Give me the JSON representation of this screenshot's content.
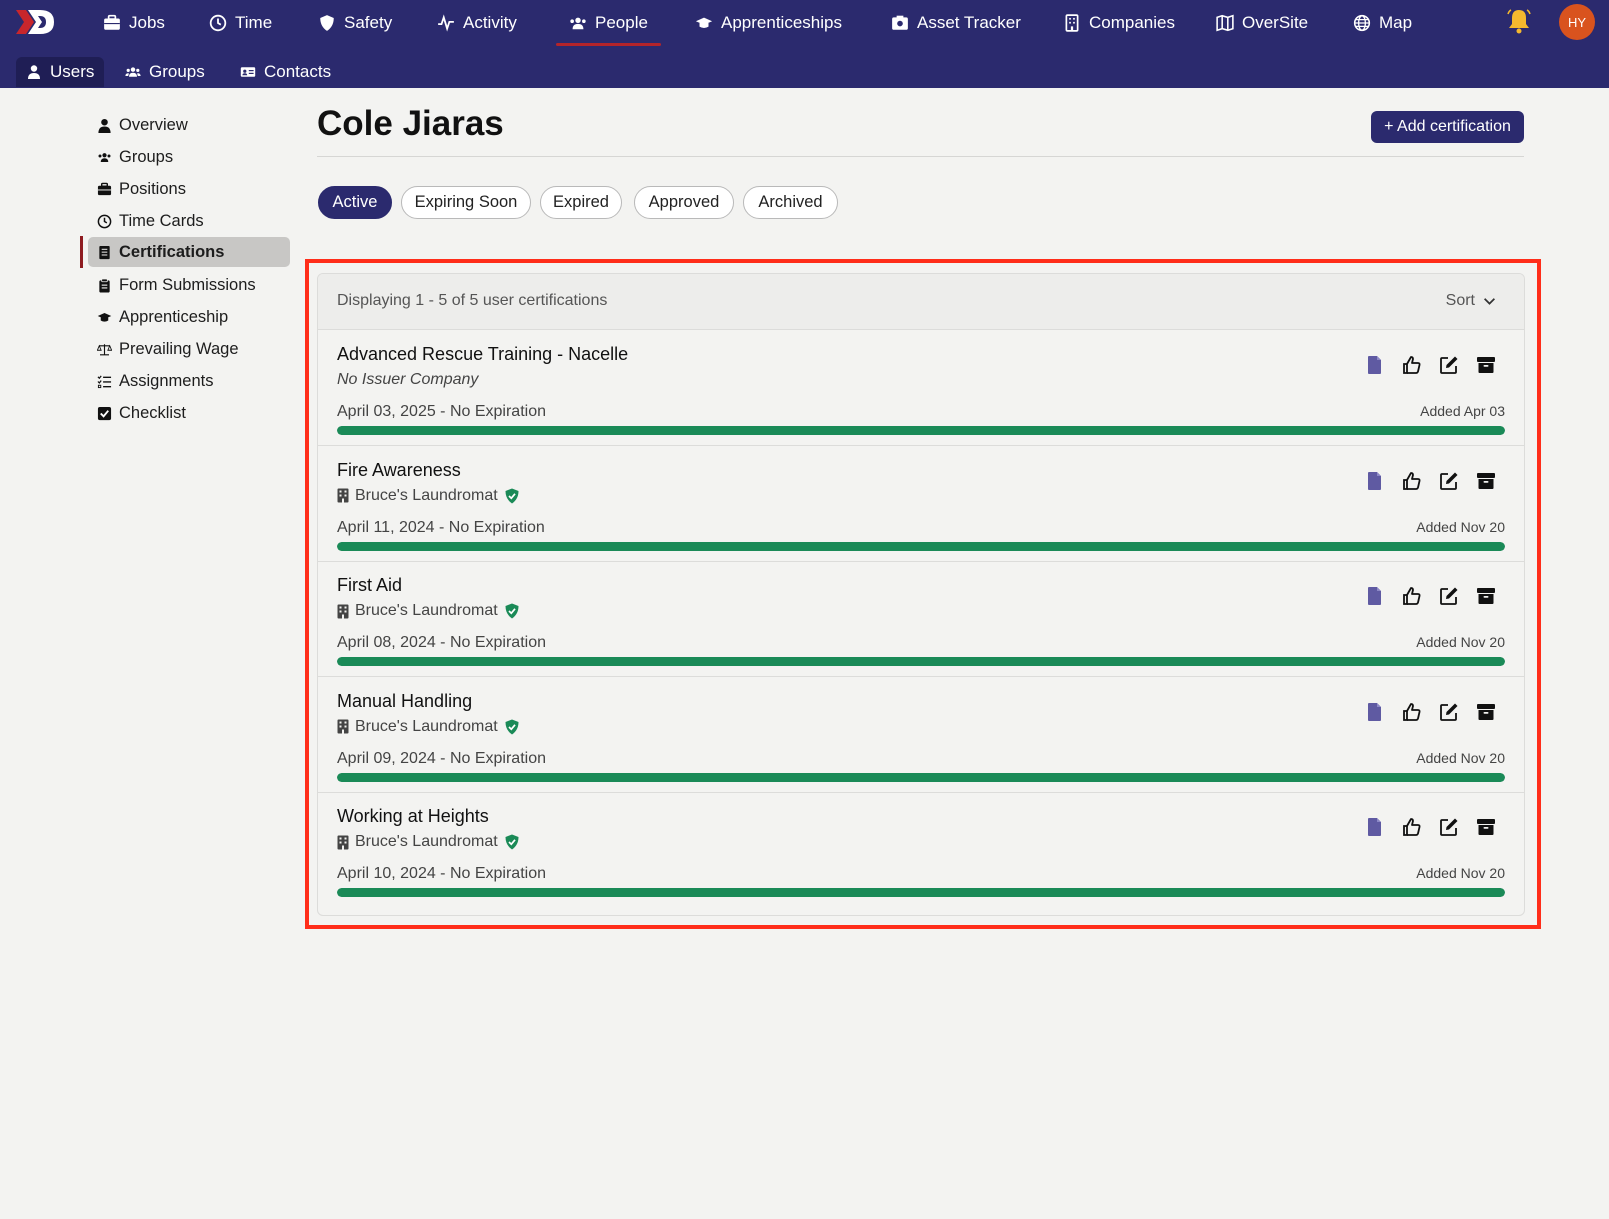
{
  "nav": {
    "items": [
      {
        "label": "Jobs",
        "icon": "briefcase-icon"
      },
      {
        "label": "Time",
        "icon": "clock-icon"
      },
      {
        "label": "Safety",
        "icon": "shield-icon"
      },
      {
        "label": "Activity",
        "icon": "pulse-icon"
      },
      {
        "label": "People",
        "icon": "people-icon",
        "active": true
      },
      {
        "label": "Apprenticeships",
        "icon": "graduation-cap-icon"
      },
      {
        "label": "Asset Tracker",
        "icon": "camera-box-icon"
      },
      {
        "label": "Companies",
        "icon": "building-icon"
      },
      {
        "label": "OverSite",
        "icon": "map-book-icon"
      },
      {
        "label": "Map",
        "icon": "globe-icon"
      }
    ],
    "avatar_initials": "HY",
    "accent": "#2b2a6e",
    "active_underline": "#b4242a"
  },
  "subnav": {
    "items": [
      {
        "label": "Users",
        "icon": "user-icon",
        "active": true
      },
      {
        "label": "Groups",
        "icon": "group-icon"
      },
      {
        "label": "Contacts",
        "icon": "id-card-icon"
      }
    ]
  },
  "sidebar": {
    "items": [
      {
        "label": "Overview",
        "icon": "user-icon"
      },
      {
        "label": "Groups",
        "icon": "group-icon"
      },
      {
        "label": "Positions",
        "icon": "briefcase-icon"
      },
      {
        "label": "Time Cards",
        "icon": "clock-icon"
      },
      {
        "label": "Certifications",
        "icon": "certificate-icon",
        "active": true
      },
      {
        "label": "Form Submissions",
        "icon": "clipboard-icon"
      },
      {
        "label": "Apprenticeship",
        "icon": "graduation-cap-icon"
      },
      {
        "label": "Prevailing Wage",
        "icon": "scale-icon"
      },
      {
        "label": "Assignments",
        "icon": "list-check-icon"
      },
      {
        "label": "Checklist",
        "icon": "checkbox-icon"
      }
    ]
  },
  "page": {
    "title": "Cole Jiaras",
    "add_button": "+ Add certification"
  },
  "filters": [
    {
      "label": "Active",
      "active": true
    },
    {
      "label": "Expiring Soon"
    },
    {
      "label": "Expired"
    },
    {
      "label": "Approved"
    },
    {
      "label": "Archived"
    }
  ],
  "list": {
    "count_text": "Displaying 1 - 5 of 5 user certifications",
    "sort_label": "Sort",
    "status_color": "#1a8a57",
    "rows": [
      {
        "name": "Advanced Rescue Training - Nacelle",
        "issuer": "No Issuer Company",
        "issuer_verified": false,
        "dates": "April 03, 2025 - No Expiration",
        "added": "Added Apr 03",
        "progress": 100
      },
      {
        "name": "Fire Awareness",
        "issuer": "Bruce's Laundromat",
        "issuer_verified": true,
        "dates": "April 11, 2024 - No Expiration",
        "added": "Added Nov 20",
        "progress": 100
      },
      {
        "name": "First Aid",
        "issuer": "Bruce's Laundromat",
        "issuer_verified": true,
        "dates": "April 08, 2024 - No Expiration",
        "added": "Added Nov 20",
        "progress": 100
      },
      {
        "name": "Manual Handling",
        "issuer": "Bruce's Laundromat",
        "issuer_verified": true,
        "dates": "April 09, 2024 - No Expiration",
        "added": "Added Nov 20",
        "progress": 100
      },
      {
        "name": "Working at Heights",
        "issuer": "Bruce's Laundromat",
        "issuer_verified": true,
        "dates": "April 10, 2024 - No Expiration",
        "added": "Added Nov 20",
        "progress": 100
      }
    ],
    "row_actions": [
      "document-icon",
      "thumbs-up-icon",
      "edit-icon",
      "archive-icon"
    ]
  }
}
